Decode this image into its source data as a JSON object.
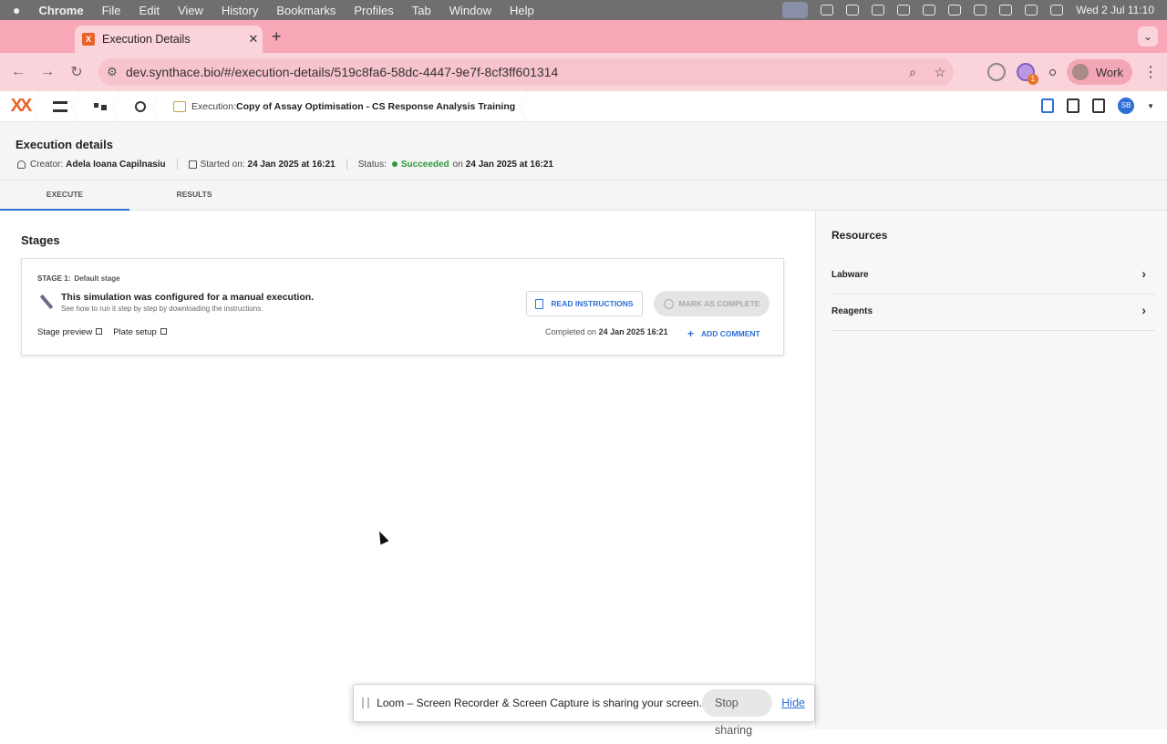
{
  "menubar": {
    "app": "Chrome",
    "items": [
      "File",
      "Edit",
      "View",
      "History",
      "Bookmarks",
      "Profiles",
      "Tab",
      "Window",
      "Help"
    ],
    "datetime": "Wed 2 Jul  11:10"
  },
  "browser": {
    "tab_title": "Execution Details",
    "url": "dev.synthace.bio/#/execution-details/519c8fa6-58dc-4447-9e7f-8cf3ff601314",
    "profile_label": "Work",
    "extension_badge": "1"
  },
  "appbar": {
    "crumb_prefix": "Execution:",
    "crumb_title": "Copy of Assay Optimisation - CS Response Analysis Training",
    "avatar_initials": "SB"
  },
  "header": {
    "title": "Execution details",
    "creator_label": "Creator:",
    "creator_name": "Adela Ioana Capilnasiu",
    "started_label": "Started on:",
    "started_value": "24 Jan 2025 at 16:21",
    "status_label": "Status:",
    "status_value": "Succeeded",
    "status_on": "on",
    "status_date": "24 Jan 2025 at 16:21",
    "status_color": "#2e9a3e"
  },
  "tabs": [
    "EXECUTE",
    "RESULTS"
  ],
  "stages": {
    "heading": "Stages",
    "stage_label": "STAGE 1:",
    "stage_name": "Default stage",
    "message": "This simulation was configured for a manual execution.",
    "sub_message": "See how to run it step by step by downloading the instructions.",
    "link_preview": "Stage preview",
    "link_plate": "Plate setup",
    "read_button": "READ INSTRUCTIONS",
    "mark_button": "MARK AS COMPLETE",
    "completed_label": "Completed on",
    "completed_value": "24 Jan 2025 16:21",
    "add_comment": "ADD COMMENT"
  },
  "resources": {
    "heading": "Resources",
    "items": [
      "Labware",
      "Reagents"
    ]
  },
  "loom": {
    "message": "Loom – Screen Recorder & Screen Capture is sharing your screen.",
    "stop": "Stop sharing",
    "hide": "Hide"
  },
  "colors": {
    "accent": "#2f6fd6",
    "brand": "#e8622a",
    "tab_bar": "#f7a7b5"
  }
}
